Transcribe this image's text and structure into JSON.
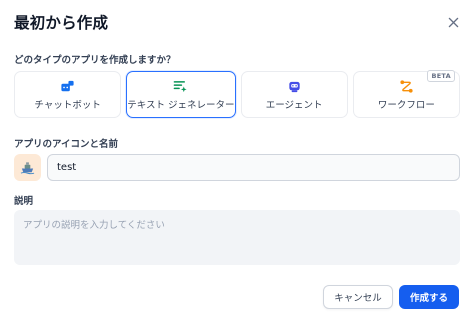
{
  "dialog": {
    "title": "最初から作成"
  },
  "type_section": {
    "label": "どのタイプのアプリを作成しますか？",
    "options": [
      {
        "label": "チャットボット",
        "icon": "chat-bot-icon",
        "selected": false
      },
      {
        "label": "テキスト ジェネレーター",
        "icon": "text-generator-icon",
        "selected": true
      },
      {
        "label": "エージェント",
        "icon": "agent-robot-icon",
        "selected": false
      },
      {
        "label": "ワークフロー",
        "icon": "workflow-icon",
        "selected": false,
        "badge": "BETA"
      }
    ]
  },
  "name_section": {
    "label": "アプリのアイコンと名前",
    "value": "test",
    "icon": "app-emoji-icon"
  },
  "description_section": {
    "label": "説明",
    "placeholder": "アプリの説明を入力してください",
    "value": ""
  },
  "buttons": {
    "cancel": "キャンセル",
    "create": "作成する"
  },
  "colors": {
    "accent": "#155eef",
    "selected_border": "#2970ff",
    "chatbot_icon": "#1570ef",
    "generator_icon": "#079455",
    "agent_icon": "#444ce7",
    "workflow_icon": "#f79009",
    "app_icon_bg": "#fde9d6"
  }
}
